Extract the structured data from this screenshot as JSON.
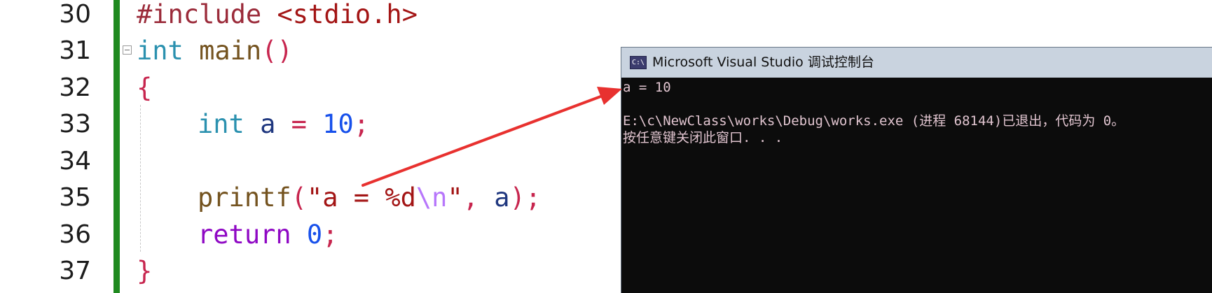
{
  "editor": {
    "line_numbers": [
      "30",
      "31",
      "32",
      "33",
      "34",
      "35",
      "36",
      "37"
    ],
    "lines": {
      "l30": {
        "include": "#include",
        "header": " <stdio.h>"
      },
      "l31": {
        "type": "int",
        "name": " main",
        "parens": "()"
      },
      "l32": {
        "brace": "{"
      },
      "l33": {
        "type": "int",
        "var": " a",
        "op": " =",
        "num": " 10",
        "semi": ";"
      },
      "l35": {
        "fn": "printf",
        "lparen": "(",
        "str_open": "\"a = %d",
        "esc": "\\n",
        "str_close": "\"",
        "comma": ",",
        "arg": " a",
        "rparen": ")",
        "semi": ";"
      },
      "l36": {
        "kw": "return",
        "num": " 0",
        "semi": ";"
      },
      "l37": {
        "brace": "}"
      }
    }
  },
  "console": {
    "icon_text": "C:\\",
    "title": "Microsoft Visual Studio 调试控制台",
    "output": [
      "a = 10",
      "",
      "E:\\c\\NewClass\\works\\Debug\\works.exe (进程 68144)已退出，代码为 0。",
      "按任意键关闭此窗口. . ."
    ]
  },
  "annotation": {
    "arrow_color": "#e8312f"
  }
}
